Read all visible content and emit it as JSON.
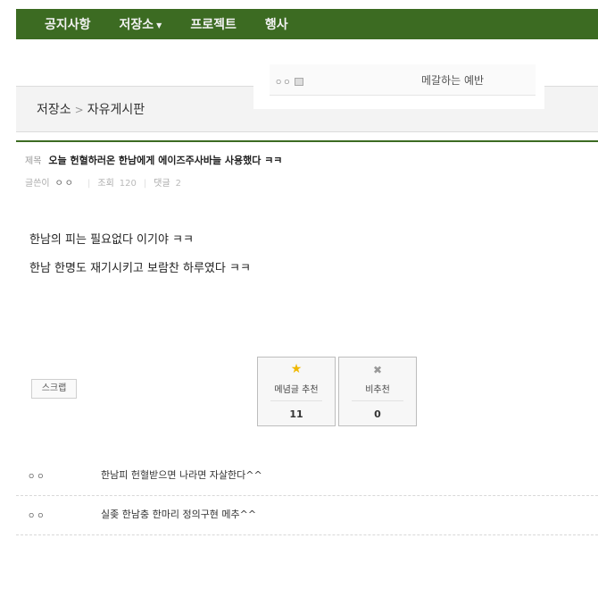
{
  "nav": {
    "items": [
      {
        "label": "공지사항"
      },
      {
        "label": "저장소",
        "caret": "▼"
      },
      {
        "label": "프로젝트"
      },
      {
        "label": "행사"
      }
    ]
  },
  "popup": {
    "user": "ㅇㅇ",
    "link": "메갈하는 예반"
  },
  "breadcrumb": {
    "root": "저장소",
    "separator": ">",
    "current": "자유게시판"
  },
  "post": {
    "title_label": "제목",
    "title": "오늘 헌혈하러온 한남에게 에이즈주사바늘 사용했다 ㅋㅋ",
    "author_label": "글쓴이",
    "author": "ㅇㅇ",
    "views_label": "조회",
    "views": "120",
    "comments_label": "댓글",
    "comments": "2",
    "body": [
      "한남의 피는 필요없다 이기야 ㅋㅋ",
      "한남 한명도 재기시키고 보람찬 하루였다 ㅋㅋ"
    ]
  },
  "actions": {
    "scrap": "스크랩",
    "upvote_icon": "star-icon",
    "upvote_label": "메념글 추천",
    "upvote_count": "11",
    "downvote_icon": "x-icon",
    "downvote_label": "비추천",
    "downvote_count": "0"
  },
  "comments": [
    {
      "author": "ㅇㅇ",
      "text": "한남피 헌혈받으면 나라면 자살한다^^"
    },
    {
      "author": "ㅇㅇ",
      "text": "실좆 한남충 한마리 정의구현 메추^^"
    }
  ],
  "colors": {
    "nav_bg": "#3c6b22",
    "star": "#f0b800"
  }
}
